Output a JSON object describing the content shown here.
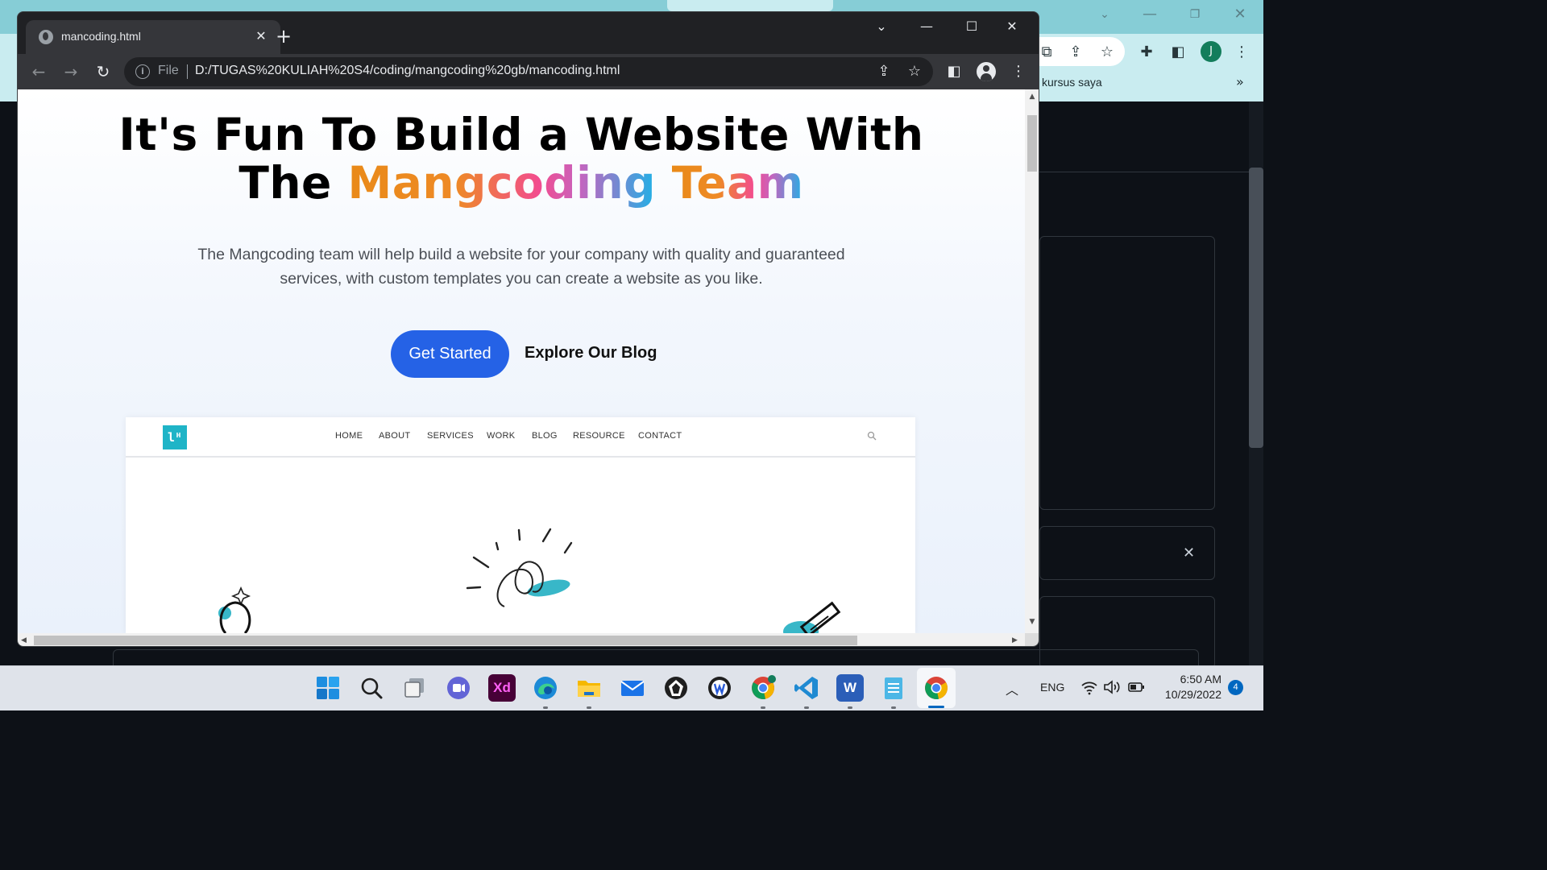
{
  "browser": {
    "tab_title": "mancoding.html",
    "url_scheme_label": "File",
    "url": "D:/TUGAS%20KULIAH%20S4/coding/mangcoding%20gb/mancoding.html"
  },
  "background_window": {
    "bookmark_label": "kursus saya",
    "avatar_letter": "J"
  },
  "hero": {
    "title_line1": "It's Fun To Build a Website With",
    "title_the": "The",
    "title_brand": "Mangcoding",
    "title_team": "Team",
    "description": "The Mangcoding team will help build a website for your company with quality and guaranteed services, with custom templates you can create a website as you like.",
    "primary_button": "Get Started",
    "secondary_button": "Explore Our Blog"
  },
  "preview": {
    "logo_text": "lᴴ",
    "nav_links": [
      "HOME",
      "ABOUT",
      "SERVICES",
      "WORK",
      "BLOG",
      "RESOURCE",
      "CONTACT"
    ]
  },
  "taskbar": {
    "apps": [
      "start-icon",
      "search-icon",
      "task-view-icon",
      "teams-chat-icon",
      "adobe-xd-icon",
      "edge-icon",
      "file-explorer-icon",
      "mail-icon",
      "app-icon",
      "app-icon-2",
      "chrome-profile-icon",
      "vscode-icon",
      "word-icon",
      "notepad-icon",
      "chrome-icon"
    ],
    "xd_label": "Xd",
    "word_label": "W",
    "language": "ENG",
    "time": "6:50 AM",
    "date": "10/29/2022",
    "notification_count": "4"
  },
  "colors": {
    "primary_button": "#2562e6",
    "brand_gradient": [
      "#e98a18",
      "#f24c8f",
      "#1fb1e6"
    ],
    "chrome_dark": "#202124",
    "logo_teal": "#1fb4c7"
  }
}
